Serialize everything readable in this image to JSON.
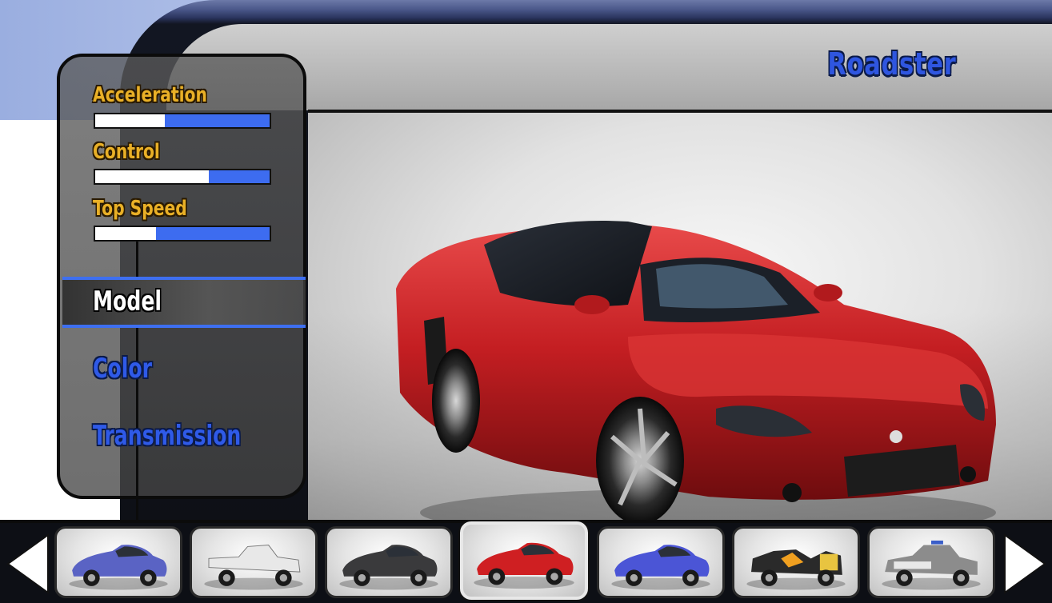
{
  "vehicle": {
    "name": "Roadster"
  },
  "stats": [
    {
      "label": "Acceleration",
      "value": 0.4
    },
    {
      "label": "Control",
      "value": 0.65
    },
    {
      "label": "Top Speed",
      "value": 0.35
    }
  ],
  "menu": {
    "items": [
      {
        "label": "Model",
        "selected": true
      },
      {
        "label": "Color",
        "selected": false
      },
      {
        "label": "Transmission",
        "selected": false
      }
    ]
  },
  "carousel": {
    "selected_index": 3,
    "cars": [
      {
        "body": "compact",
        "color": "#5a63c4"
      },
      {
        "body": "pickup",
        "color": "#e8e8e8"
      },
      {
        "body": "coupe",
        "color": "#3a3a3c"
      },
      {
        "body": "roadster",
        "color": "#cf1f22"
      },
      {
        "body": "roadster",
        "color": "#4b55d6"
      },
      {
        "body": "hotrod",
        "color": "#2a2a2a"
      },
      {
        "body": "police-sedan",
        "color": "#8c8c8c"
      }
    ]
  },
  "colors": {
    "accent_blue": "#3e6ff0",
    "stat_label": "#e9b027",
    "main_car": "#c41e22"
  },
  "icons": {
    "prev": "left-arrow-icon",
    "next": "right-arrow-icon"
  }
}
